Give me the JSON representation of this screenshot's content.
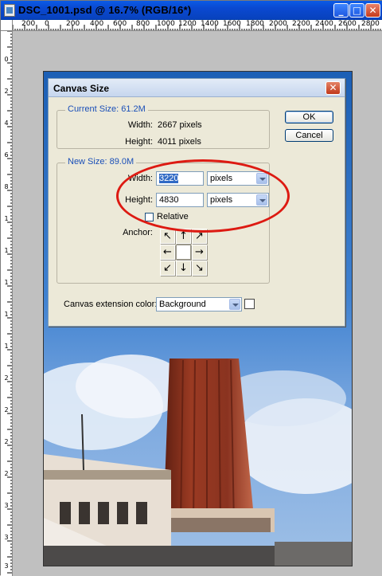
{
  "window": {
    "title": "DSC_1001.psd @ 16.7% (RGB/16*)",
    "min_label": "_",
    "max_label": "□",
    "close_label": "✕"
  },
  "ruler_top": {
    "labels": [
      "200",
      "0",
      "200",
      "400",
      "600",
      "800",
      "1000",
      "1200",
      "1400",
      "1600",
      "1800",
      "2000",
      "2200",
      "2400",
      "2600",
      "2800"
    ]
  },
  "ruler_left": {
    "labels": [
      "0",
      "2",
      "4",
      "6",
      "8",
      "1",
      "1",
      "1",
      "1",
      "1",
      "2",
      "2",
      "2",
      "2",
      "3",
      "3",
      "3"
    ]
  },
  "dialog": {
    "title": "Canvas Size",
    "close_label": "✕",
    "ok_label": "OK",
    "cancel_label": "Cancel",
    "current_size": {
      "legend": "Current Size: 61.2M",
      "width_label": "Width:",
      "width_value": "2667 pixels",
      "height_label": "Height:",
      "height_value": "4011 pixels"
    },
    "new_size": {
      "legend": "New Size: 89.0M",
      "width_label": "Width:",
      "width_value": "3220",
      "width_unit": "pixels",
      "height_label": "Height:",
      "height_value": "4830",
      "height_unit": "pixels",
      "relative_label": "Relative",
      "relative_checked": false,
      "anchor_label": "Anchor:"
    },
    "extension": {
      "label": "Canvas extension color:",
      "value": "Background",
      "swatch_color": "#ffffff"
    }
  },
  "annotation": {
    "color": "#dd1a12"
  }
}
